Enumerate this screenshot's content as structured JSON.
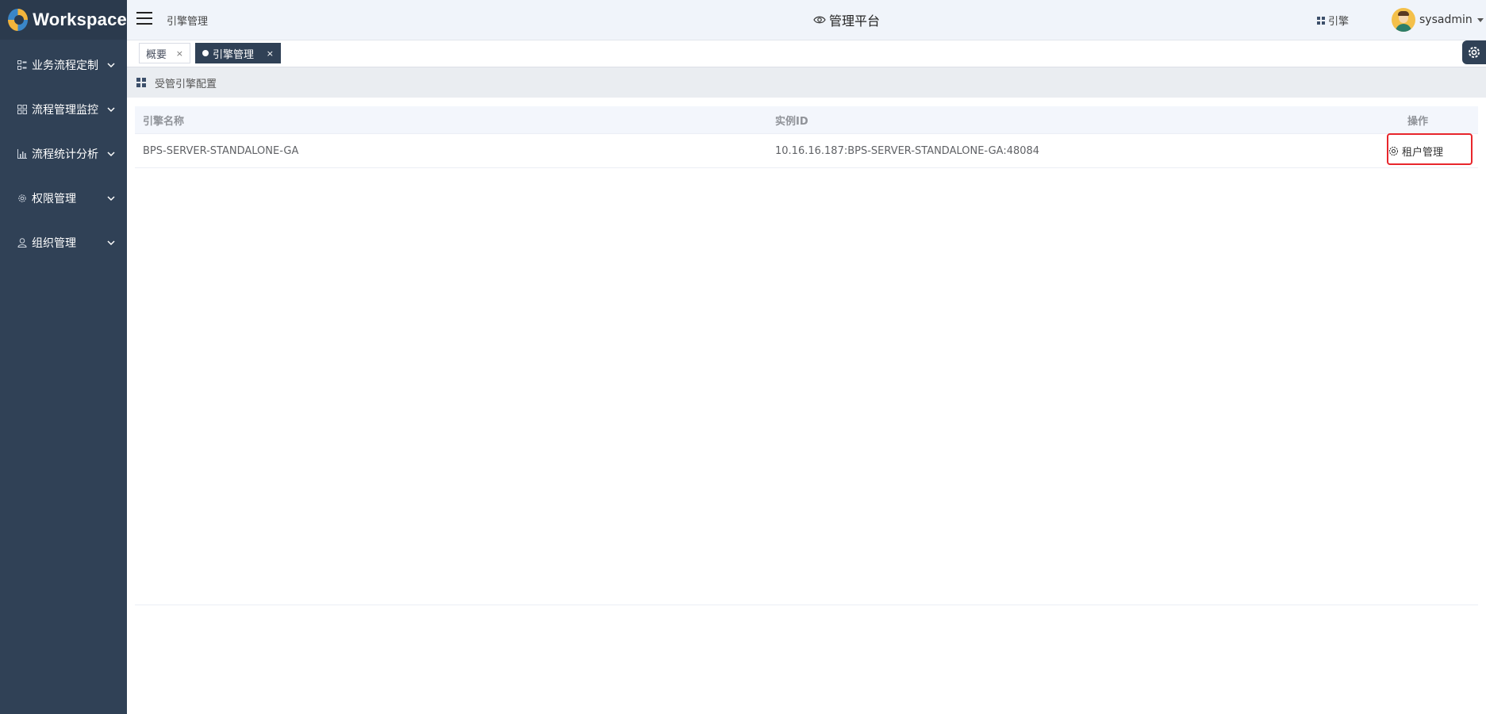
{
  "app": {
    "logo_text": "Workspace"
  },
  "sidebar": {
    "items": [
      {
        "label": "业务流程定制",
        "icon": "workflow-icon"
      },
      {
        "label": "流程管理监控",
        "icon": "grid-icon"
      },
      {
        "label": "流程统计分析",
        "icon": "bar-chart-icon"
      },
      {
        "label": "权限管理",
        "icon": "gear-icon"
      },
      {
        "label": "组织管理",
        "icon": "user-icon"
      }
    ]
  },
  "header": {
    "breadcrumb": "引擎管理",
    "center_title": "管理平台",
    "engine_link": "引擎",
    "user_name": "sysadmin"
  },
  "tabs": [
    {
      "label": "概要",
      "close": "×",
      "active": false
    },
    {
      "label": "引擎管理",
      "close": "×",
      "active": true
    }
  ],
  "section": {
    "title": "受管引擎配置"
  },
  "table": {
    "columns": [
      "引擎名称",
      "实例ID",
      "操作"
    ],
    "rows": [
      {
        "name": "BPS-SERVER-STANDALONE-GA",
        "instance_id": "10.16.16.187:BPS-SERVER-STANDALONE-GA:48084",
        "action": "租户管理"
      }
    ]
  },
  "colors": {
    "sidebar": "#304156",
    "header": "#f0f4fa",
    "highlight": "#e8262c"
  }
}
